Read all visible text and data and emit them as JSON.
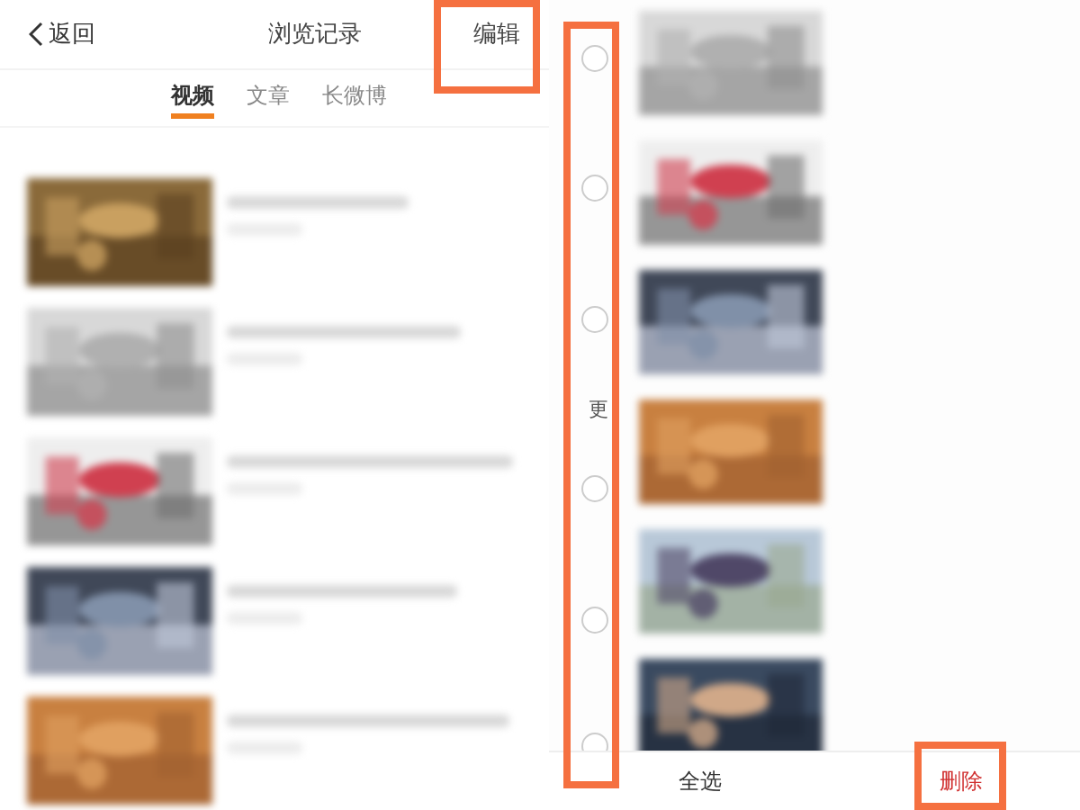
{
  "left_screen": {
    "back": {
      "label": "返回"
    },
    "title": "浏览记录",
    "edit": "编辑",
    "tabs": [
      {
        "label": "视频",
        "selected": true
      },
      {
        "label": "文章",
        "selected": false
      },
      {
        "label": "长微博",
        "selected": false
      }
    ]
  },
  "right_screen": {
    "more_label": "更",
    "radios": [
      {
        "selected": false
      },
      {
        "selected": false
      },
      {
        "selected": false
      },
      {
        "selected": false
      },
      {
        "selected": false
      },
      {
        "selected": false
      }
    ],
    "select_all": "全选",
    "delete": "删除"
  }
}
